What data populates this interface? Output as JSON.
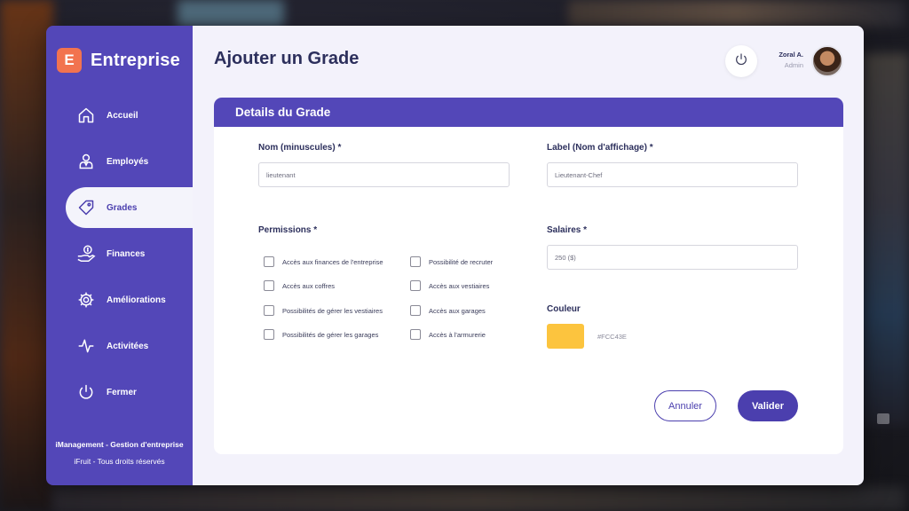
{
  "colors": {
    "sidebar": "#5347b8",
    "accent": "#4b3fae",
    "brand_logo": "#f2734f",
    "main_bg": "#f3f2fb",
    "title_text": "#2c2f5c"
  },
  "sidebar": {
    "brand_letter": "E",
    "brand_name": "Entreprise",
    "items": [
      {
        "label": "Accueil",
        "icon": "home-icon"
      },
      {
        "label": "Employés",
        "icon": "user-icon"
      },
      {
        "label": "Grades",
        "icon": "tag-icon",
        "active": true
      },
      {
        "label": "Finances",
        "icon": "money-hand-icon"
      },
      {
        "label": "Améliorations",
        "icon": "gear-icon"
      },
      {
        "label": "Activitées",
        "icon": "activity-icon"
      },
      {
        "label": "Fermer",
        "icon": "power-icon"
      }
    ],
    "footer_title": "iManagement - Gestion d'entreprise",
    "footer_sub": "iFruit - Tous droits réservés"
  },
  "header": {
    "title": "Ajouter un Grade",
    "user_name": "Zoral A.",
    "user_role": "Admin"
  },
  "form": {
    "section_title": "Details du Grade",
    "name_label": "Nom (minuscules) *",
    "name_value": "lieutenant",
    "display_label": "Label (Nom d'affichage) *",
    "display_value": "Lieutenant-Chef",
    "permissions_label": "Permissions *",
    "permissions": [
      "Accès aux finances de l'entreprise",
      "Accès aux coffres",
      "Possibilités de gérer les vestiaires",
      "Possibilités de gérer les garages",
      "Possibilité de recruter",
      "Accès aux vestiaires",
      "Accès aux garages",
      "Accès à l'armurerie"
    ],
    "salary_label": "Salaires *",
    "salary_value": "250 ($)",
    "color_label": "Couleur",
    "color_value": "#FCC43E",
    "cancel_label": "Annuler",
    "submit_label": "Valider"
  }
}
